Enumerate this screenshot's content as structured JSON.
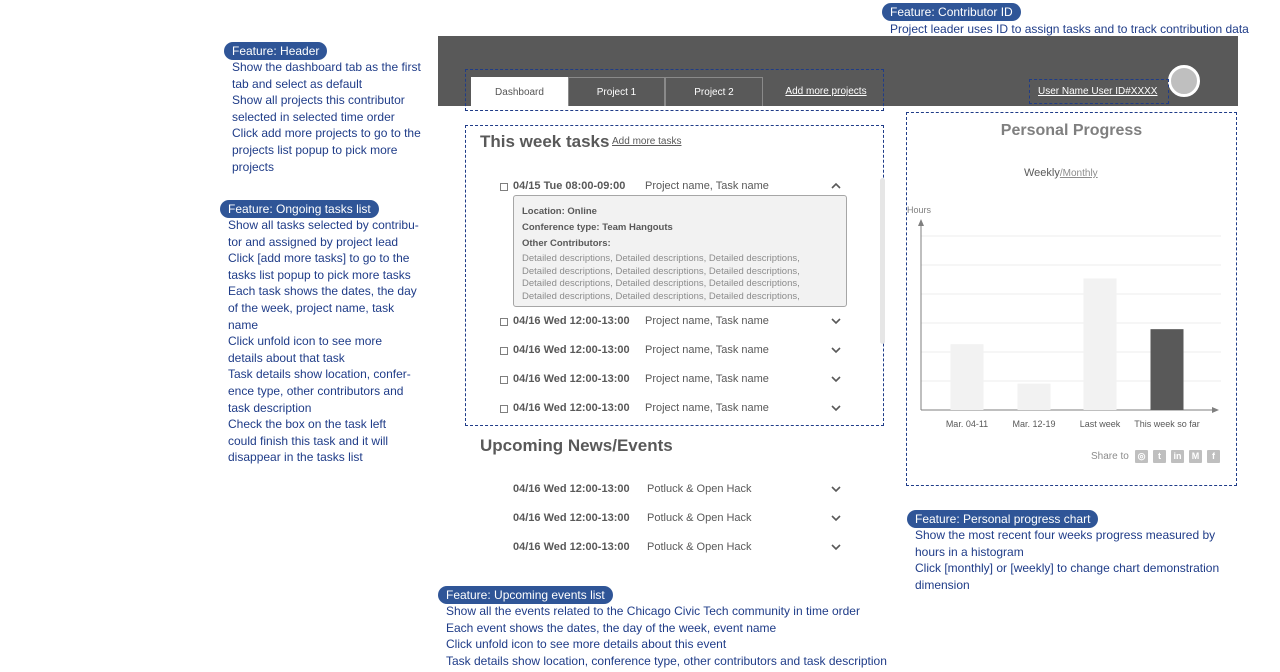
{
  "annotations": {
    "contributor": {
      "pill": "Feature: Contributor ID",
      "lines": [
        "Project leader uses ID to assign tasks and to track contribution data"
      ]
    },
    "header": {
      "pill": "Feature: Header",
      "lines": [
        "Show the dashboard tab as the first",
        "tab and select as default",
        "Show all projects this contributor",
        "selected in selected time order",
        "Click add more projects to go to the",
        "projects list popup to pick more",
        "projects"
      ]
    },
    "ongoing": {
      "pill": "Feature: Ongoing tasks list",
      "lines": [
        "Show all tasks selected by contribu-",
        "tor and assigned by project lead",
        "Click [add more tasks] to go to the",
        "tasks list popup to pick more tasks",
        "Each task shows the dates, the day",
        "of the week, project name, task",
        "name",
        "Click unfold icon to see more",
        "details about that task",
        "Task details show location, confer-",
        "ence type, other contributors and",
        "task description",
        "Check the box  on the task left",
        "could finish this task and it will",
        "disappear in the tasks list"
      ]
    },
    "progress": {
      "pill": "Feature: Personal progress chart",
      "lines": [
        "Show the most recent four weeks progress measured by",
        "hours in a histogram",
        "Click [monthly] or [weekly] to change chart demonstration",
        "dimension"
      ]
    },
    "upcoming": {
      "pill": "Feature: Upcoming events list",
      "lines": [
        "Show all the events related to the Chicago Civic Tech community in time order",
        "Each event shows the dates, the day of the week, event name",
        "Click unfold icon to see more details about this event",
        "Task details show location, conference type, other contributors and task description"
      ]
    }
  },
  "header": {
    "tabs": [
      {
        "label": "Dashboard"
      },
      {
        "label": "Project 1"
      },
      {
        "label": "Project 2"
      }
    ],
    "add_projects": "Add more projects",
    "user": "User Name User ID#XXXX"
  },
  "tasks": {
    "title": "This week tasks",
    "add_link": "Add more tasks",
    "items": [
      {
        "date": "04/15 Tue 08:00-09:00",
        "name": "Project name, Task name"
      },
      {
        "date": "04/16 Wed 12:00-13:00",
        "name": "Project name, Task name"
      },
      {
        "date": "04/16 Wed 12:00-13:00",
        "name": "Project name, Task name"
      },
      {
        "date": "04/16 Wed 12:00-13:00",
        "name": "Project name, Task name"
      },
      {
        "date": "04/16 Wed 12:00-13:00",
        "name": "Project name, Task name"
      }
    ],
    "details": {
      "location": "Location: Online",
      "conference": "Conference type: Team Hangouts",
      "contributors": "Other Contributors:",
      "desc": [
        "Detailed descriptions, Detailed descriptions, Detailed descriptions,",
        "Detailed descriptions, Detailed descriptions, Detailed descriptions,",
        "Detailed descriptions, Detailed descriptions, Detailed descriptions,",
        "Detailed descriptions, Detailed descriptions, Detailed descriptions,"
      ]
    }
  },
  "events": {
    "title": "Upcoming News/Events",
    "items": [
      {
        "date": "04/16 Wed 12:00-13:00",
        "name": "Potluck & Open Hack"
      },
      {
        "date": "04/16 Wed 12:00-13:00",
        "name": "Potluck & Open Hack"
      },
      {
        "date": "04/16 Wed 12:00-13:00",
        "name": "Potluck & Open Hack"
      }
    ]
  },
  "progress": {
    "title": "Personal Progress",
    "toggle_active": "Weekly",
    "toggle_inactive": "/Monthly",
    "share_label": "Share to",
    "share_icons": [
      "instagram-icon",
      "twitter-icon",
      "linkedin-icon",
      "medium-icon",
      "facebook-icon"
    ]
  },
  "chart_data": {
    "type": "bar",
    "ylabel": "Hours",
    "categories": [
      "Mar. 04-11",
      "Mar. 12-19",
      "Last week",
      "This week so far"
    ],
    "values": [
      3.5,
      1.4,
      7.0,
      4.3
    ],
    "ylim": [
      0,
      10
    ],
    "grid": true,
    "colors": [
      "#f2f2f2",
      "#f2f2f2",
      "#f2f2f2",
      "#595959"
    ]
  }
}
